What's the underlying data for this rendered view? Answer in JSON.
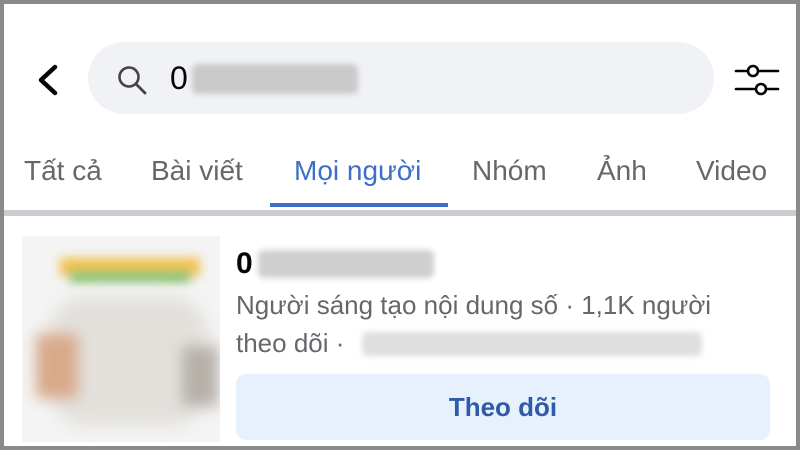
{
  "search": {
    "query_visible": "0"
  },
  "tabs": [
    {
      "label": "Tất cả",
      "active": false
    },
    {
      "label": "Bài viết",
      "active": false
    },
    {
      "label": "Mọi người",
      "active": true
    },
    {
      "label": "Nhóm",
      "active": false
    },
    {
      "label": "Ảnh",
      "active": false
    },
    {
      "label": "Video",
      "active": false
    }
  ],
  "result": {
    "name_visible": "0",
    "meta_line1": "Người sáng tạo nội dung số · 1,1K người",
    "meta_line2": "theo dõi ·",
    "follow_label": "Theo dõi"
  },
  "icons": {
    "back": "chevron-left-icon",
    "search": "search-icon",
    "filter": "filter-sliders-icon"
  },
  "colors": {
    "accent": "#3b6fc9",
    "search_bg": "#f0f2f5",
    "button_bg": "#e7f0fd",
    "muted_text": "#65676b"
  }
}
